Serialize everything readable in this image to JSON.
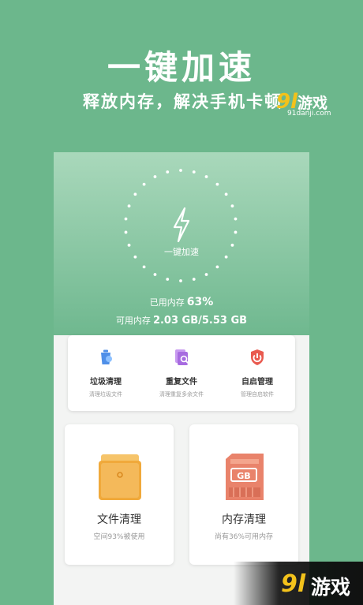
{
  "promo": {
    "headline": "一键加速",
    "subline": "释放内存，解决手机卡顿"
  },
  "watermark": {
    "logo": "9l",
    "name": "游戏",
    "url": "91danji.com"
  },
  "boost": {
    "label": "一键加速",
    "used_label": "已用内存",
    "used_percent": "63%",
    "available_label": "可用内存",
    "available_value": "2.03 GB/5.53 GB"
  },
  "tools": [
    {
      "title": "垃圾清理",
      "subtitle": "清理垃圾文件",
      "icon": "trash-clean-icon"
    },
    {
      "title": "重复文件",
      "subtitle": "清理重复多余文件",
      "icon": "duplicate-file-icon"
    },
    {
      "title": "自启管理",
      "subtitle": "管理自启软件",
      "icon": "shield-icon"
    }
  ],
  "cards": [
    {
      "title": "文件清理",
      "subtitle": "空间93%被使用",
      "icon": "folder-icon"
    },
    {
      "title": "内存清理",
      "subtitle": "尚有36%可用内存",
      "icon": "memory-card-icon"
    }
  ],
  "colors": {
    "background": "#6cb78c",
    "accent_gold": "#f3c21b",
    "folder_orange": "#f0a93b",
    "memory_red": "#e9836b"
  }
}
